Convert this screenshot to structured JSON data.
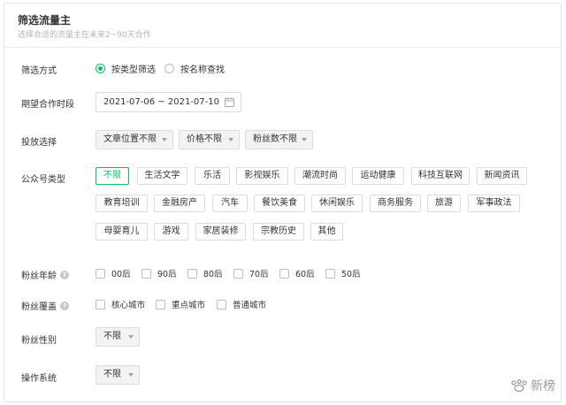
{
  "header": {
    "title": "筛选流量主",
    "subtitle": "选择合适的流量主在未来2~90天合作"
  },
  "filter_mode": {
    "label": "筛选方式",
    "options": [
      "按类型筛选",
      "按名称查找"
    ],
    "selected": "按类型筛选"
  },
  "period": {
    "label": "期望合作时段",
    "value": "2021-07-06 ~ 2021-07-10",
    "icon": "calendar-icon"
  },
  "placement": {
    "label": "投放选择",
    "selects": [
      "文章位置不限",
      "价格不限",
      "粉丝数不限"
    ]
  },
  "account_type": {
    "label": "公众号类型",
    "tags": [
      "不限",
      "生活文学",
      "乐活",
      "影视娱乐",
      "潮流时尚",
      "运动健康",
      "科技互联网",
      "新闻资讯",
      "教育培训",
      "金融房产",
      "汽车",
      "餐饮美食",
      "休闲娱乐",
      "商务服务",
      "旅游",
      "军事政法",
      "母婴育儿",
      "游戏",
      "家居装修",
      "宗教历史",
      "其他"
    ],
    "selected": "不限"
  },
  "fan_age": {
    "label": "粉丝年龄",
    "options": [
      "00后",
      "90后",
      "80后",
      "70后",
      "60后",
      "50后"
    ]
  },
  "fan_coverage": {
    "label": "粉丝覆盖",
    "options": [
      "核心城市",
      "重点城市",
      "普通城市"
    ]
  },
  "fan_gender": {
    "label": "粉丝性别",
    "value": "不限"
  },
  "os": {
    "label": "操作系统",
    "value": "不限"
  },
  "watermark": {
    "text": "新榜"
  },
  "colors": {
    "accent": "#07c160",
    "border": "#dcdcdc",
    "muted": "#b4b4b4"
  }
}
